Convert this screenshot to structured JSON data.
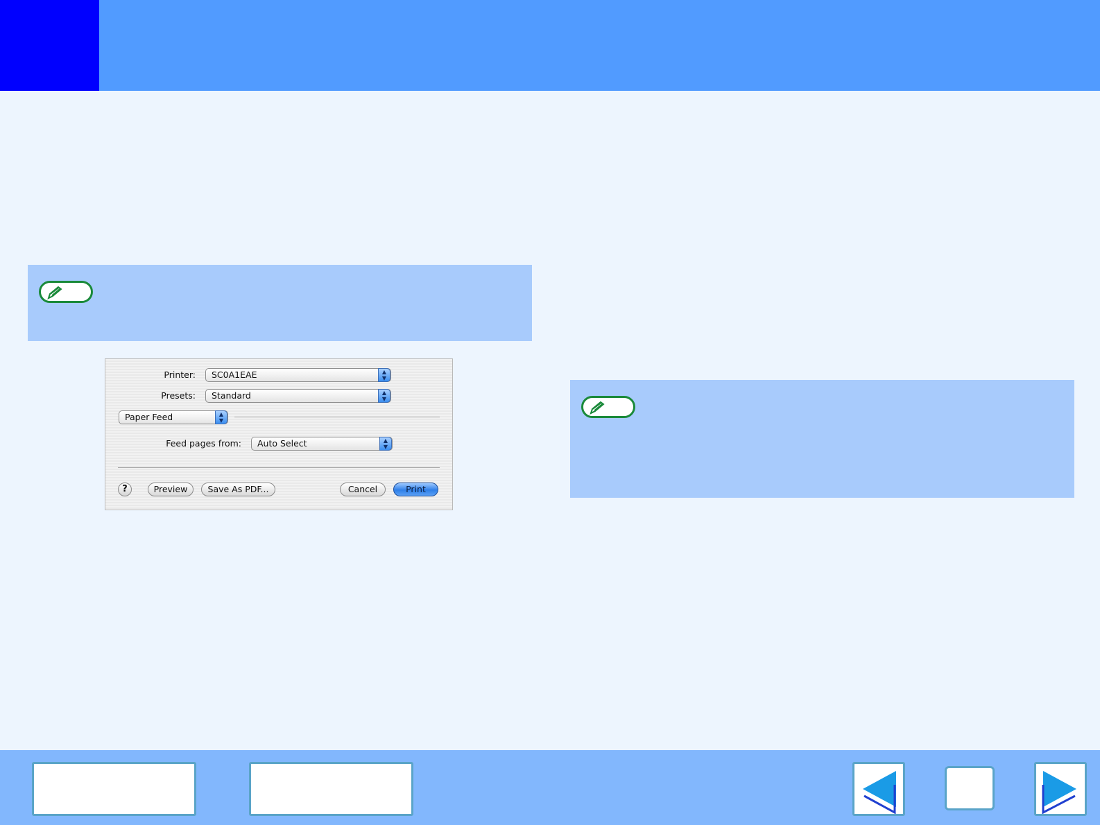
{
  "header": {
    "title": ""
  },
  "notes": [
    {
      "icon": "pencil-note-icon",
      "text": ""
    },
    {
      "icon": "pencil-note-icon",
      "text": ""
    }
  ],
  "dialog": {
    "printer_label": "Printer:",
    "printer_value": "SC0A1EAE",
    "presets_label": "Presets:",
    "presets_value": "Standard",
    "panel_value": "Paper Feed",
    "feed_label": "Feed pages from:",
    "feed_value": "Auto Select",
    "help_label": "?",
    "preview_label": "Preview",
    "save_pdf_label": "Save As PDF...",
    "cancel_label": "Cancel",
    "print_label": "Print"
  },
  "footer": {
    "contents_label": "",
    "index_label": "",
    "prev_icon": "arrow-left-icon",
    "home_icon": "home-icon",
    "next_icon": "arrow-right-icon"
  },
  "colors": {
    "header": "#519bff",
    "header_corner": "#0000ff",
    "background": "#edf5fe",
    "note": "#a8cbfc",
    "footer": "#82b7fd",
    "arrow": "#1a9be6"
  }
}
